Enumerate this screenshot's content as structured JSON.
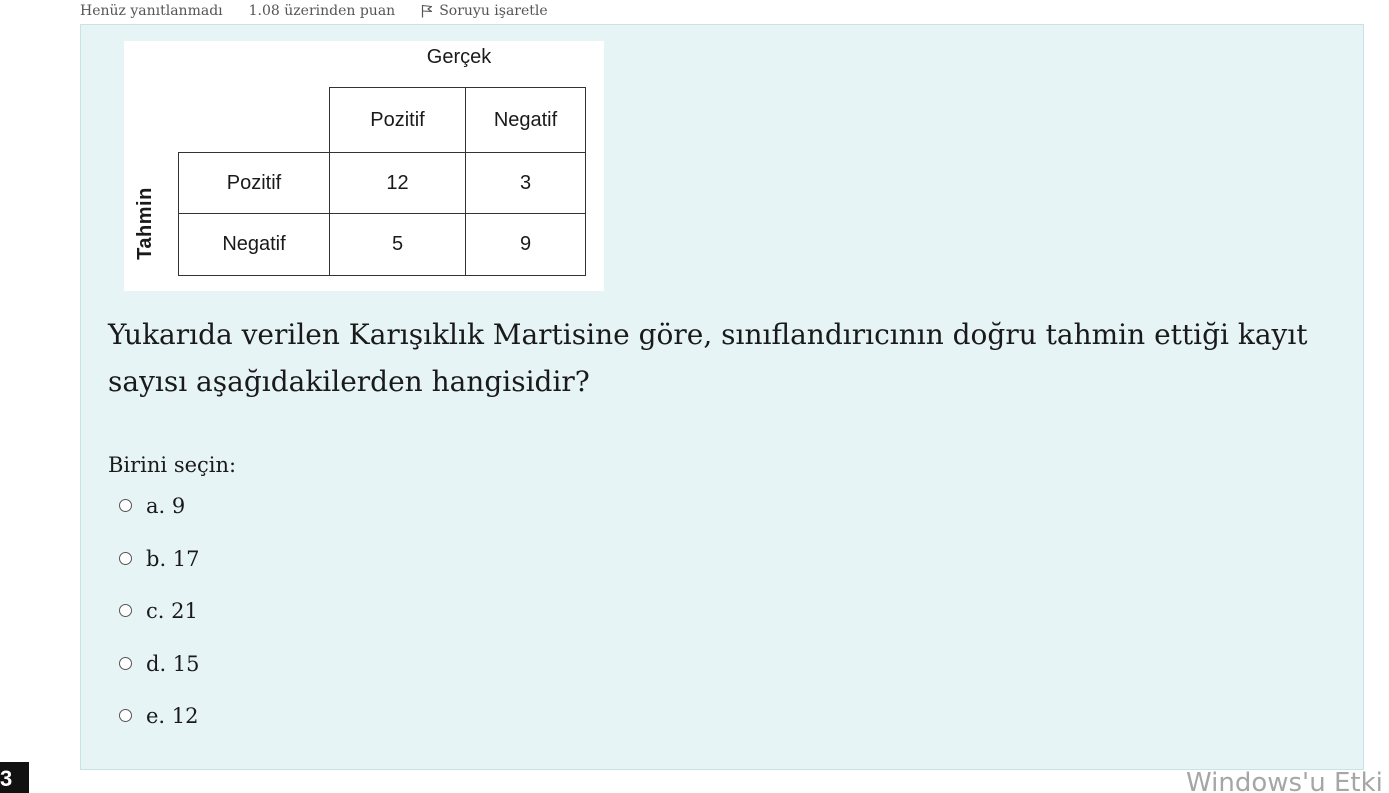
{
  "meta": {
    "status": "Henüz yanıtlanmadı",
    "points": "1.08 üzerinden puan",
    "flag_label": "Soruyu işaretle"
  },
  "matrix": {
    "actual_title": "Gerçek",
    "predicted_title": "Tahmin",
    "col_headers": [
      "Pozitif",
      "Negatif"
    ],
    "row_headers": [
      "Pozitif",
      "Negatif"
    ],
    "values": [
      [
        "12",
        "3"
      ],
      [
        "5",
        "9"
      ]
    ]
  },
  "question": {
    "text": "Yukarıda verilen Karışıklık Martisine göre, sınıflandırıcının doğru tahmin ettiği kayıt sayısı aşağıdakilerden hangisidir?",
    "prompt": "Birini seçin:"
  },
  "answers": [
    {
      "label": "a. 9"
    },
    {
      "label": "b. 17"
    },
    {
      "label": "c. 21"
    },
    {
      "label": "d. 15"
    },
    {
      "label": "e. 12"
    }
  ],
  "question_number": "3",
  "watermark": "Windows'u Etki"
}
